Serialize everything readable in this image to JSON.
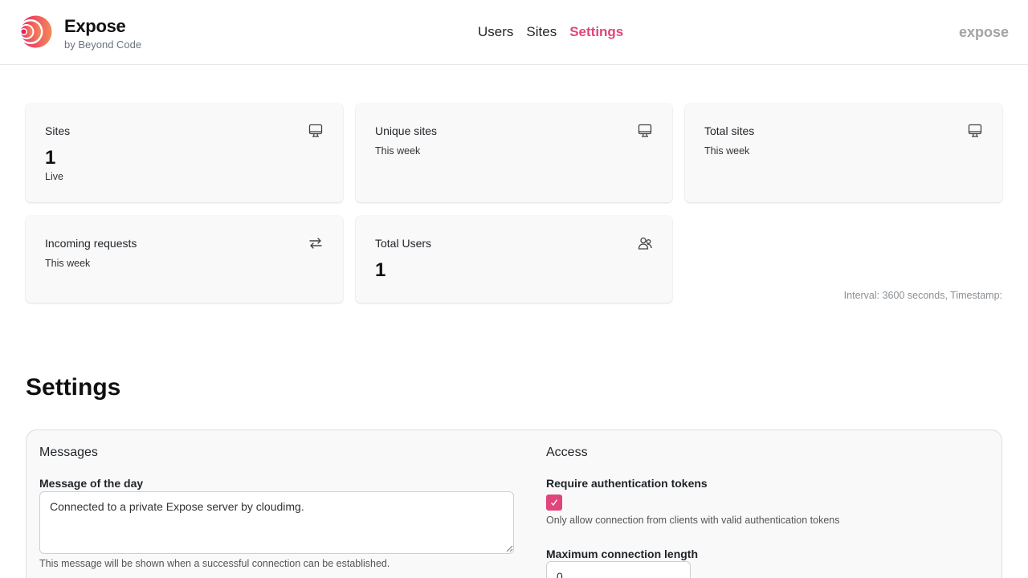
{
  "header": {
    "brand_title": "Expose",
    "brand_subtitle": "by Beyond Code",
    "nav": [
      {
        "label": "Users",
        "active": false
      },
      {
        "label": "Sites",
        "active": false
      },
      {
        "label": "Settings",
        "active": true
      }
    ],
    "right_label": "expose"
  },
  "stats": [
    {
      "title": "Sites",
      "value": "1",
      "sub": "Live",
      "icon": "monitor-icon"
    },
    {
      "title": "Unique sites",
      "value": "",
      "sub": "This week",
      "icon": "monitor-icon"
    },
    {
      "title": "Total sites",
      "value": "",
      "sub": "This week",
      "icon": "monitor-icon"
    },
    {
      "title": "Incoming requests",
      "value": "",
      "sub": "This week",
      "icon": "arrows-exchange-icon"
    },
    {
      "title": "Total Users",
      "value": "1",
      "sub": "",
      "icon": "users-icon"
    }
  ],
  "interval_text": "Interval: 3600 seconds, Timestamp:",
  "settings": {
    "heading": "Settings",
    "messages": {
      "title": "Messages",
      "motd_label": "Message of the day",
      "motd_value": "Connected to a private Expose server by cloudimg.",
      "motd_help": "This message will be shown when a successful connection can be established."
    },
    "access": {
      "title": "Access",
      "auth_label": "Require authentication tokens",
      "auth_checked": true,
      "auth_help": "Only allow connection from clients with valid authentication tokens",
      "max_length_label": "Maximum connection length",
      "max_length_value": "0"
    }
  },
  "colors": {
    "accent": "#e0457b",
    "card_bg": "#f9f9f9",
    "muted": "#8b8f94"
  }
}
